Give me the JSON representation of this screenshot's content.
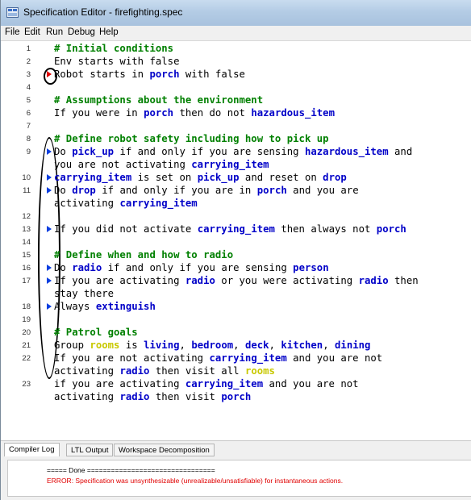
{
  "window": {
    "title": "Specification Editor - firefighting.spec"
  },
  "menu": [
    {
      "name": "menu-file",
      "label": "File"
    },
    {
      "name": "menu-edit",
      "label": "Edit"
    },
    {
      "name": "menu-run",
      "label": "Run"
    },
    {
      "name": "menu-debug",
      "label": "Debug"
    },
    {
      "name": "menu-help",
      "label": "Help"
    }
  ],
  "editor": {
    "lines": [
      {
        "n": "1",
        "marker": "",
        "segs": [
          {
            "t": "# Initial conditions",
            "c": "comment"
          }
        ]
      },
      {
        "n": "2",
        "marker": "",
        "segs": [
          {
            "t": "Env starts with false",
            "c": ""
          }
        ]
      },
      {
        "n": "3",
        "marker": "red",
        "segs": [
          {
            "t": "Robot starts in ",
            "c": ""
          },
          {
            "t": "porch",
            "c": "kw"
          },
          {
            "t": " with false",
            "c": ""
          }
        ]
      },
      {
        "n": "4",
        "marker": "",
        "segs": []
      },
      {
        "n": "5",
        "marker": "",
        "segs": [
          {
            "t": "# Assumptions about the environment",
            "c": "comment"
          }
        ]
      },
      {
        "n": "6",
        "marker": "",
        "segs": [
          {
            "t": "If you were in ",
            "c": ""
          },
          {
            "t": "porch",
            "c": "kw"
          },
          {
            "t": " then do not ",
            "c": ""
          },
          {
            "t": "hazardous_item",
            "c": "kw"
          }
        ]
      },
      {
        "n": "7",
        "marker": "",
        "segs": []
      },
      {
        "n": "8",
        "marker": "",
        "segs": [
          {
            "t": "# Define robot safety including how to pick up",
            "c": "comment"
          }
        ]
      },
      {
        "n": "9",
        "marker": "blue",
        "segs": [
          {
            "t": "Do ",
            "c": ""
          },
          {
            "t": "pick_up",
            "c": "kw"
          },
          {
            "t": " if and only if you are sensing ",
            "c": ""
          },
          {
            "t": "hazardous_item",
            "c": "kw"
          },
          {
            "t": " and",
            "c": ""
          }
        ]
      },
      {
        "n": "",
        "marker": "",
        "segs": [
          {
            "t": "you are not activating ",
            "c": ""
          },
          {
            "t": "carrying_item",
            "c": "kw"
          }
        ]
      },
      {
        "n": "10",
        "marker": "blue",
        "segs": [
          {
            "t": "carrying_item",
            "c": "kw"
          },
          {
            "t": " is set on ",
            "c": ""
          },
          {
            "t": "pick_up",
            "c": "kw"
          },
          {
            "t": " and reset on ",
            "c": ""
          },
          {
            "t": "drop",
            "c": "kw"
          }
        ]
      },
      {
        "n": "11",
        "marker": "blue",
        "segs": [
          {
            "t": "Do ",
            "c": ""
          },
          {
            "t": "drop",
            "c": "kw"
          },
          {
            "t": " if and only if you are in ",
            "c": ""
          },
          {
            "t": "porch",
            "c": "kw"
          },
          {
            "t": " and you are",
            "c": ""
          }
        ]
      },
      {
        "n": "",
        "marker": "",
        "segs": [
          {
            "t": "activating ",
            "c": ""
          },
          {
            "t": "carrying_item",
            "c": "kw"
          }
        ]
      },
      {
        "n": "12",
        "marker": "",
        "segs": []
      },
      {
        "n": "13",
        "marker": "blue",
        "segs": [
          {
            "t": "If you did not activate ",
            "c": ""
          },
          {
            "t": "carrying_item",
            "c": "kw"
          },
          {
            "t": " then always not ",
            "c": ""
          },
          {
            "t": "porch",
            "c": "kw"
          }
        ]
      },
      {
        "n": "14",
        "marker": "",
        "segs": []
      },
      {
        "n": "15",
        "marker": "",
        "segs": [
          {
            "t": "# Define when and how to radio",
            "c": "comment"
          }
        ]
      },
      {
        "n": "16",
        "marker": "blue",
        "segs": [
          {
            "t": "Do ",
            "c": ""
          },
          {
            "t": "radio",
            "c": "kw"
          },
          {
            "t": " if and only if you are sensing ",
            "c": ""
          },
          {
            "t": "person",
            "c": "kw"
          }
        ]
      },
      {
        "n": "17",
        "marker": "blue",
        "segs": [
          {
            "t": "If you are activating ",
            "c": ""
          },
          {
            "t": "radio",
            "c": "kw"
          },
          {
            "t": " or you were activating ",
            "c": ""
          },
          {
            "t": "radio",
            "c": "kw"
          },
          {
            "t": " then",
            "c": ""
          }
        ]
      },
      {
        "n": "",
        "marker": "",
        "segs": [
          {
            "t": "stay there",
            "c": ""
          }
        ]
      },
      {
        "n": "18",
        "marker": "blue",
        "segs": [
          {
            "t": "Always ",
            "c": ""
          },
          {
            "t": "extinguish",
            "c": "kw"
          }
        ]
      },
      {
        "n": "19",
        "marker": "",
        "segs": []
      },
      {
        "n": "20",
        "marker": "",
        "segs": [
          {
            "t": "# Patrol goals",
            "c": "comment"
          }
        ]
      },
      {
        "n": "21",
        "marker": "",
        "segs": [
          {
            "t": "Group ",
            "c": ""
          },
          {
            "t": "rooms",
            "c": "grp"
          },
          {
            "t": " is ",
            "c": ""
          },
          {
            "t": "living",
            "c": "kw"
          },
          {
            "t": ", ",
            "c": ""
          },
          {
            "t": "bedroom",
            "c": "kw"
          },
          {
            "t": ", ",
            "c": ""
          },
          {
            "t": "deck",
            "c": "kw"
          },
          {
            "t": ", ",
            "c": ""
          },
          {
            "t": "kitchen",
            "c": "kw"
          },
          {
            "t": ", ",
            "c": ""
          },
          {
            "t": "dining",
            "c": "kw"
          }
        ]
      },
      {
        "n": "22",
        "marker": "",
        "segs": [
          {
            "t": "If you are not activating ",
            "c": ""
          },
          {
            "t": "carrying_item",
            "c": "kw"
          },
          {
            "t": " and you are not",
            "c": ""
          }
        ]
      },
      {
        "n": "",
        "marker": "",
        "segs": [
          {
            "t": "activating ",
            "c": ""
          },
          {
            "t": "radio",
            "c": "kw"
          },
          {
            "t": " then visit all ",
            "c": ""
          },
          {
            "t": "rooms",
            "c": "grp"
          }
        ]
      },
      {
        "n": "23",
        "marker": "",
        "segs": [
          {
            "t": "if you are activating ",
            "c": ""
          },
          {
            "t": "carrying_item",
            "c": "kw"
          },
          {
            "t": " and you are not",
            "c": ""
          }
        ]
      },
      {
        "n": "",
        "marker": "",
        "segs": [
          {
            "t": "activating ",
            "c": ""
          },
          {
            "t": "radio",
            "c": "kw"
          },
          {
            "t": " then visit ",
            "c": ""
          },
          {
            "t": "porch",
            "c": "kw"
          }
        ]
      }
    ]
  },
  "tabs": [
    {
      "name": "tab-compiler-log",
      "label": "Compiler Log",
      "active": true
    },
    {
      "name": "tab-ltl-output",
      "label": "LTL Output",
      "active": false
    },
    {
      "name": "tab-workspace-decomposition",
      "label": "Workspace Decomposition",
      "active": false
    }
  ],
  "log": {
    "done": "===== Done ================================",
    "error": "ERROR: Specification was unsynthesizable (unrealizable/unsatisfiable) for instantaneous actions."
  },
  "colors": {
    "comment": "#008000",
    "keyword": "#0000c8",
    "group": "#c8c800",
    "error": "#e00000",
    "marker_blue": "#0b3fe0",
    "marker_red": "#e00000"
  }
}
